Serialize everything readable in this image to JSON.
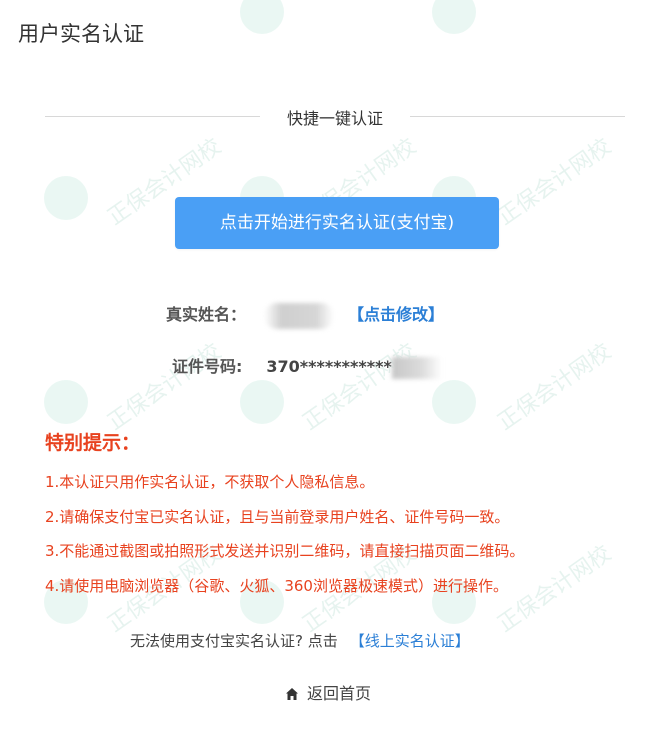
{
  "page": {
    "title": "用户实名认证"
  },
  "quick_auth": {
    "divider_label": "快捷一键认证",
    "button_label": "点击开始进行实名认证(支付宝)"
  },
  "identity": {
    "name_label": "真实姓名：",
    "edit_link": "【点击修改】",
    "id_label": "证件号码:",
    "id_value": "370***********"
  },
  "notice": {
    "title": "特别提示：",
    "items": [
      "1.本认证只用作实名认证，不获取个人隐私信息。",
      "2.请确保支付宝已实名认证，且与当前登录用户姓名、证件号码一致。",
      "3.不能通过截图或拍照形式发送并识别二维码，请直接扫描页面二维码。",
      "4.请使用电脑浏览器（谷歌、火狐、360浏览器极速模式）进行操作。"
    ]
  },
  "alternative": {
    "text": "无法使用支付宝实名认证? 点击",
    "link": "【线上实名认证】"
  },
  "home": {
    "label": "返回首页",
    "icon": "home-icon"
  },
  "watermark": {
    "text": "正保会计网校",
    "url": "www.chinaacc.com"
  },
  "colors": {
    "primary_button": "#4a9ff5",
    "link": "#2b7fd6",
    "notice": "#e8421f"
  }
}
